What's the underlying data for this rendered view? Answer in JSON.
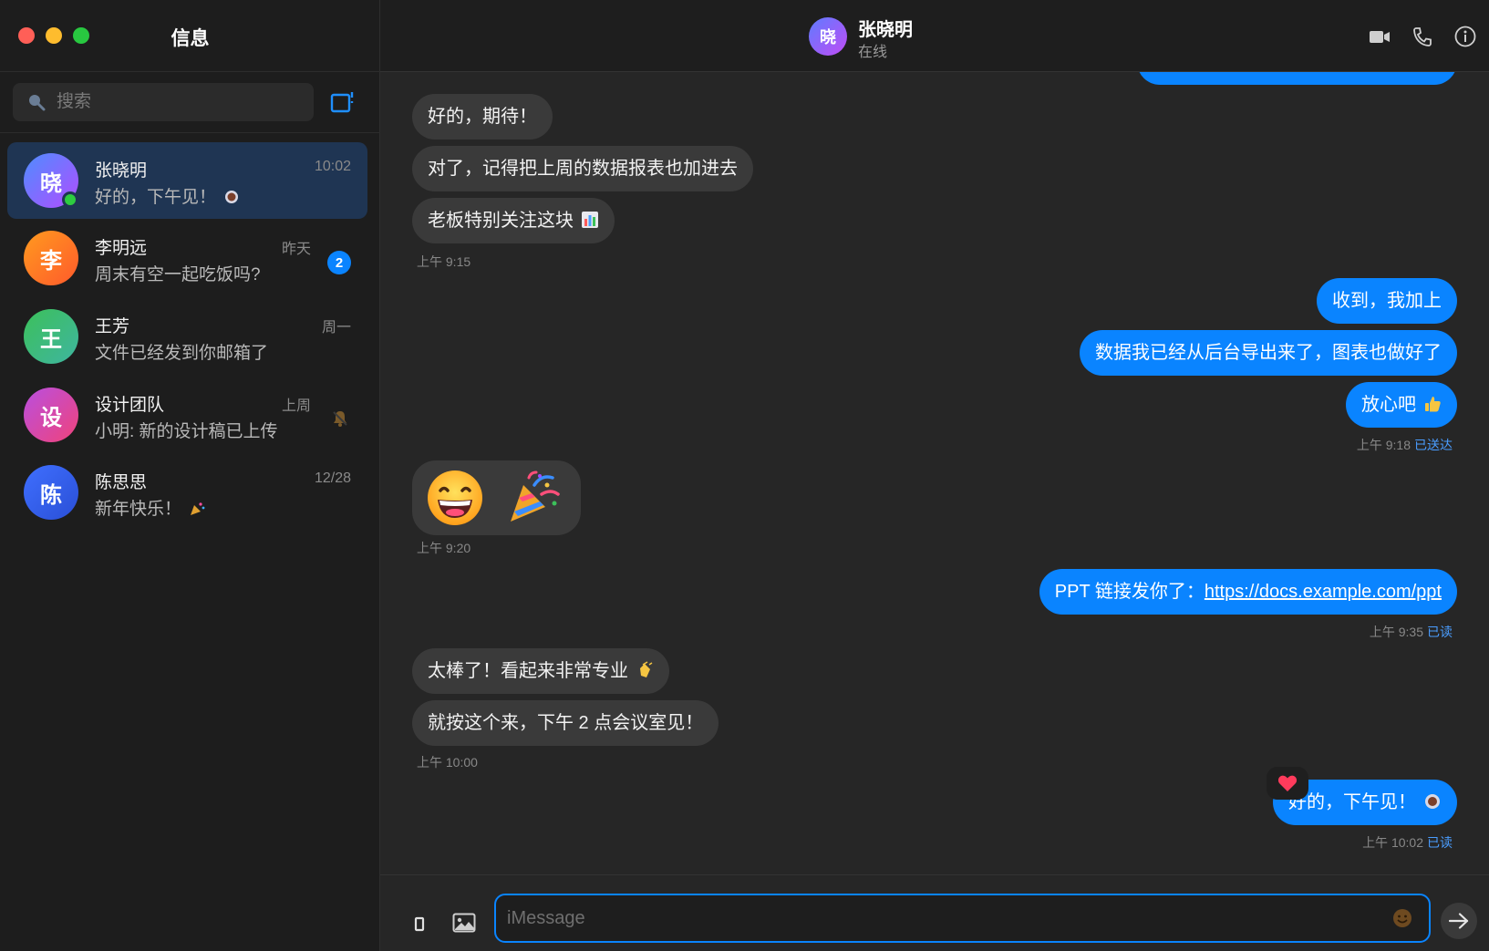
{
  "sidebar": {
    "title": "信息",
    "search_placeholder": "搜索",
    "conversations": [
      {
        "name": "张晓明",
        "avatar": "晓",
        "preview": "好的，下午见！",
        "time": "10:02",
        "online": true,
        "emoji": "coffee-icon"
      },
      {
        "name": "李明远",
        "avatar": "李",
        "preview": "周末有空一起吃饭吗?",
        "time": "昨天",
        "unread": "2"
      },
      {
        "name": "王芳",
        "avatar": "王",
        "preview": "文件已经发到你邮箱了",
        "time": "周一"
      },
      {
        "name": "设计团队",
        "avatar": "设",
        "preview": "小明: 新的设计稿已上传",
        "time": "上周",
        "muted": true
      },
      {
        "name": "陈思思",
        "avatar": "陈",
        "preview": "新年快乐！",
        "time": "12/28",
        "emoji": "party-popper-icon"
      }
    ]
  },
  "chat": {
    "contact_name": "张晓明",
    "contact_avatar": "晓",
    "contact_status": "在线",
    "messages": {
      "m1": "好的，期待！",
      "m2": "对了，记得把上周的数据报表也加进去",
      "m3": "老板特别关注这块",
      "t1": "上午 9:15",
      "m4": "收到，我加上",
      "m5": "数据我已经从后台导出来了，图表也做好了",
      "m6": "放心吧",
      "t2": "上午 9:18",
      "t2_status": "已送达",
      "t3": "上午 9:20",
      "m7_prefix": "PPT 链接发你了：",
      "m7_link": "https://docs.example.com/ppt",
      "t4": "上午 9:35",
      "t4_status": "已读",
      "m8": "太棒了！看起来非常专业",
      "m9": "就按这个来，下午 2 点会议室见！",
      "t5": "上午 10:00",
      "m10": "好的，下午见！",
      "t6": "上午 10:02",
      "t6_status": "已读"
    },
    "composer_placeholder": "iMessage"
  },
  "colors": {
    "accent": "#0a84ff",
    "outgoing_bubble": "#0a84ff",
    "incoming_bubble": "#3a3a3a",
    "online": "#2ecc40",
    "active_row": "#1f3553"
  }
}
